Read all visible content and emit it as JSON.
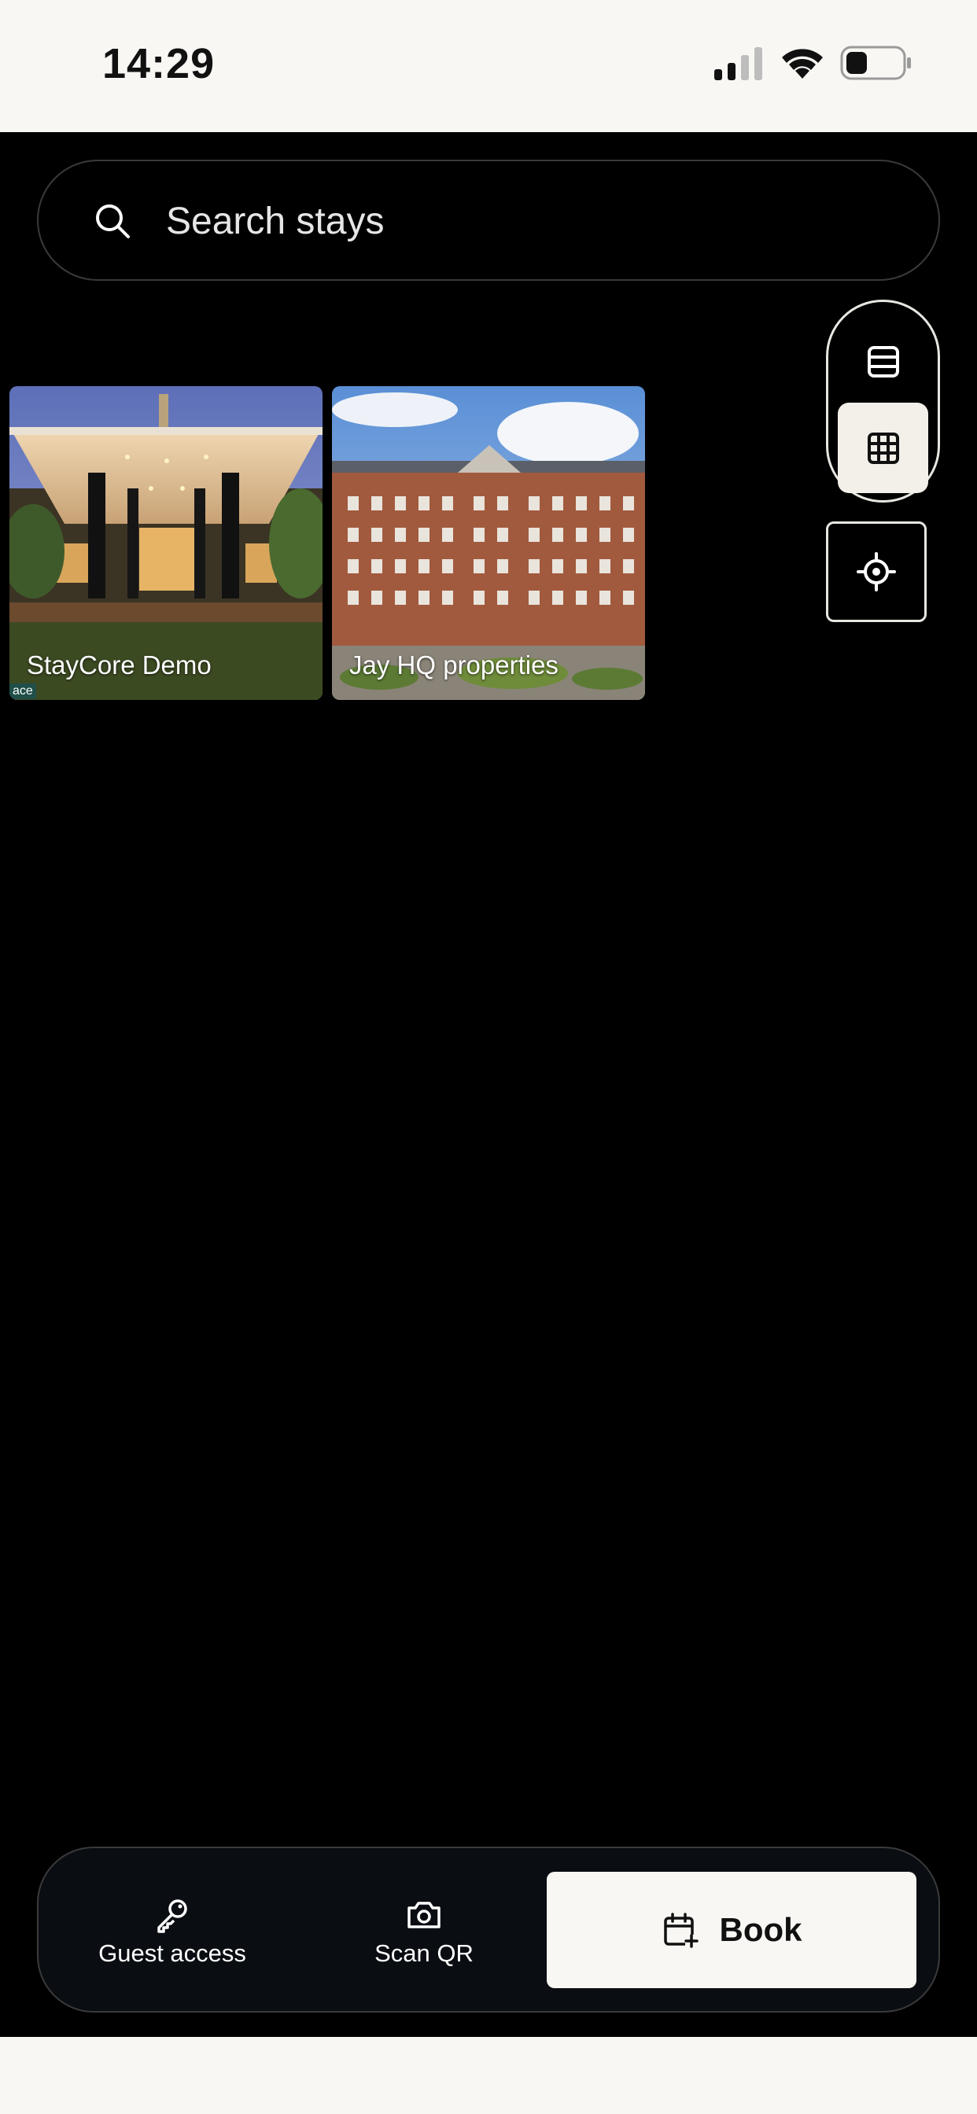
{
  "status_bar": {
    "time": "14:29"
  },
  "search": {
    "placeholder": "Search stays"
  },
  "view_toggle": {
    "list_icon": "list-view-icon",
    "grid_icon": "grid-view-icon",
    "selected": "grid"
  },
  "locate": {
    "icon": "crosshair-icon"
  },
  "properties": [
    {
      "name": "StayCore Demo",
      "tag": "ace"
    },
    {
      "name": "Jay HQ properties"
    }
  ],
  "bottom_bar": {
    "guest_access": {
      "label": "Guest access",
      "icon": "key-icon"
    },
    "scan_qr": {
      "label": "Scan QR",
      "icon": "camera-icon"
    },
    "book": {
      "label": "Book",
      "icon": "calendar-plus-icon"
    }
  },
  "colors": {
    "background": "#000000",
    "surface_light": "#f9f7f3",
    "border": "#3a3a3a"
  }
}
